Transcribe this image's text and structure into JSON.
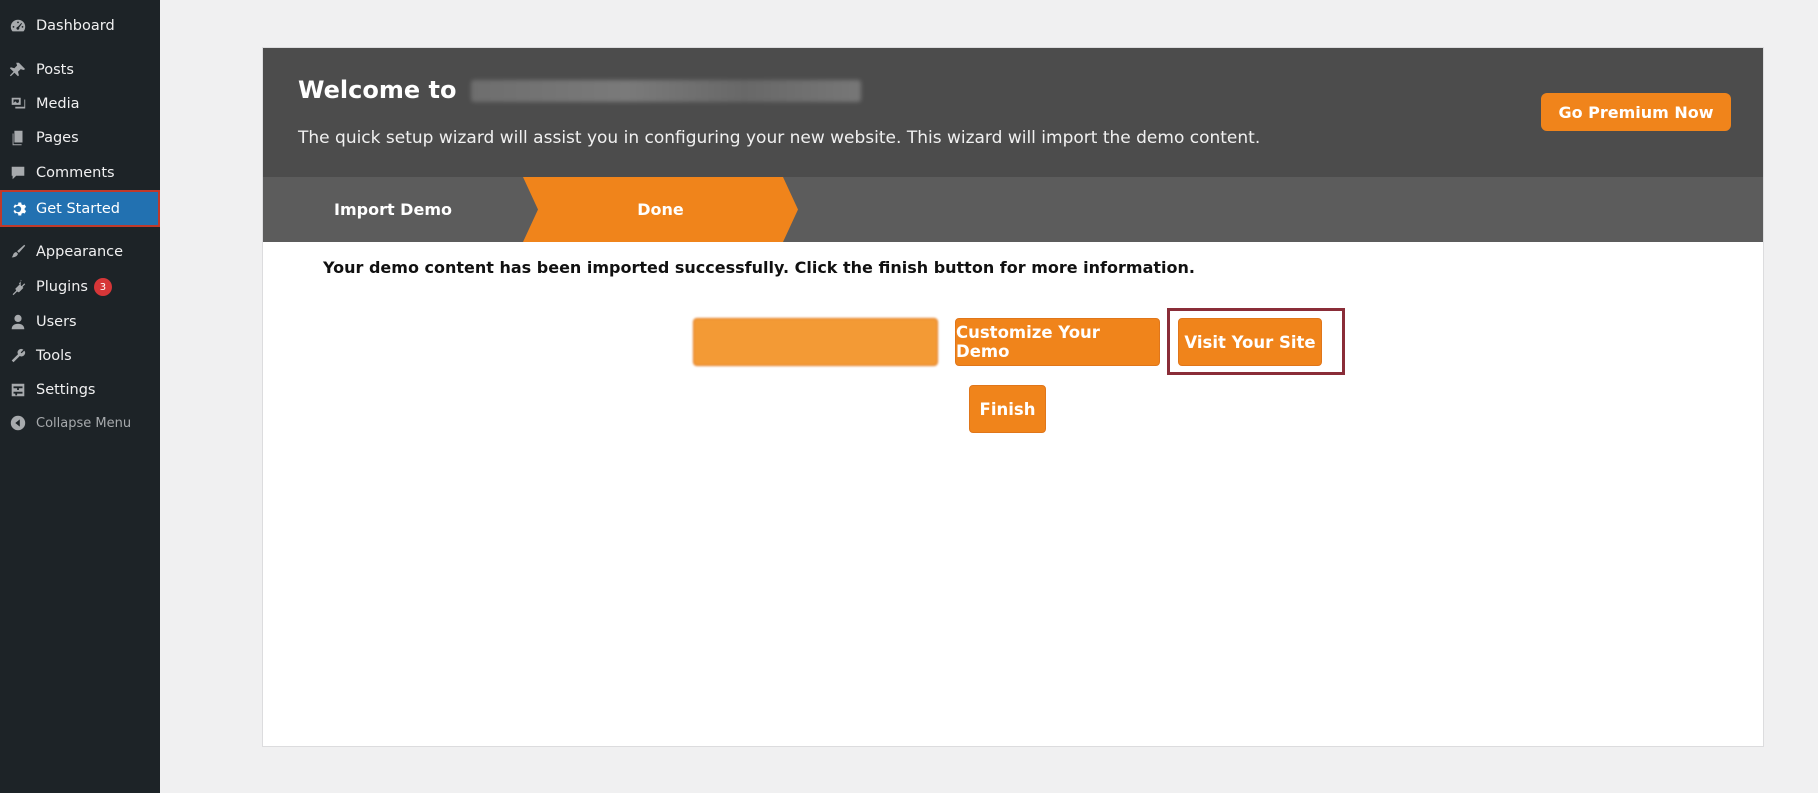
{
  "sidebar": {
    "items": [
      {
        "label": "Dashboard",
        "icon": "dashboard-icon"
      },
      {
        "label": "Posts",
        "icon": "pin-icon"
      },
      {
        "label": "Media",
        "icon": "media-icon"
      },
      {
        "label": "Pages",
        "icon": "pages-icon"
      },
      {
        "label": "Comments",
        "icon": "comment-icon"
      },
      {
        "label": "Get Started",
        "icon": "gear-icon"
      },
      {
        "label": "Appearance",
        "icon": "brush-icon"
      },
      {
        "label": "Plugins",
        "icon": "plugin-icon",
        "badge": "3"
      },
      {
        "label": "Users",
        "icon": "user-icon"
      },
      {
        "label": "Tools",
        "icon": "wrench-icon"
      },
      {
        "label": "Settings",
        "icon": "settings-icon"
      },
      {
        "label": "Collapse Menu",
        "icon": "collapse-icon"
      }
    ]
  },
  "header": {
    "title": "Welcome to",
    "description": "The quick setup wizard will assist you in configuring your new website. This wizard will import the demo content.",
    "premium_button": "Go Premium Now"
  },
  "steps": [
    "Import Demo",
    "Done"
  ],
  "message": "Your demo content has been imported successfully. Click the finish button for more information.",
  "buttons": {
    "customize": "Customize Your Demo",
    "visit": "Visit Your Site",
    "finish": "Finish"
  },
  "colors": {
    "accent": "#f0841b",
    "sidebar_bg": "#1d2327",
    "active": "#2271b1",
    "header_bg": "#4c4c4c",
    "steps_bg": "#5c5c5c"
  }
}
